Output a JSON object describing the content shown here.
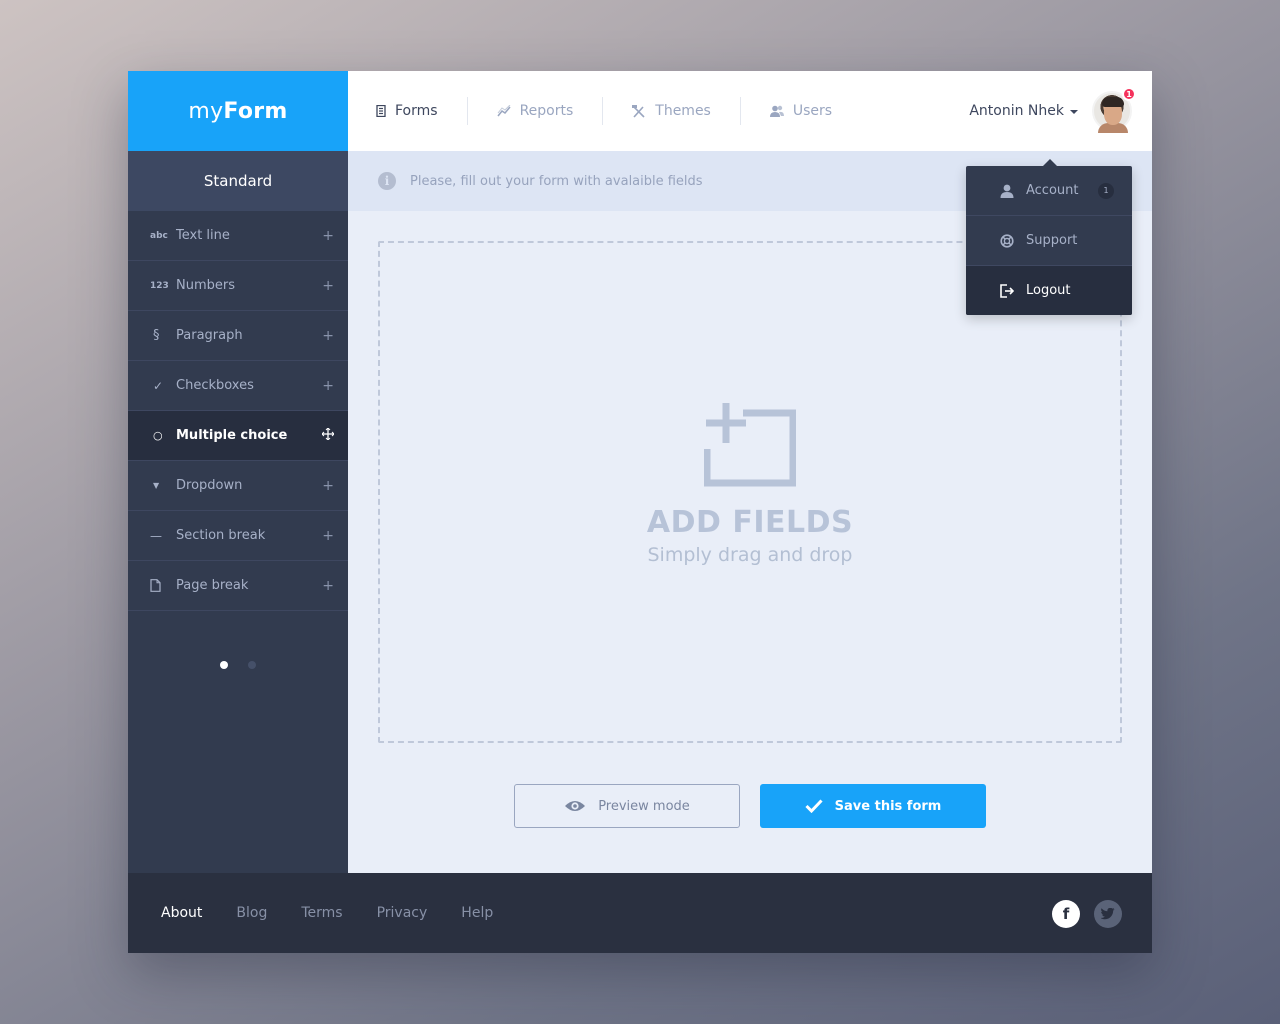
{
  "app": {
    "logo_light": "my",
    "logo_bold": "Form"
  },
  "nav": {
    "items": [
      {
        "label": "Forms",
        "icon": "form-icon"
      },
      {
        "label": "Reports",
        "icon": "chart-icon"
      },
      {
        "label": "Themes",
        "icon": "tools-icon"
      },
      {
        "label": "Users",
        "icon": "users-icon"
      }
    ],
    "user_name": "Antonin Nhek",
    "notification_count": "1"
  },
  "user_menu": {
    "items": [
      {
        "label": "Account",
        "badge": "1"
      },
      {
        "label": "Support"
      },
      {
        "label": "Logout"
      }
    ]
  },
  "sidebar": {
    "title": "Standard",
    "items": [
      {
        "icon_text": "abc",
        "label": "Text line"
      },
      {
        "icon_text": "123",
        "label": "Numbers"
      },
      {
        "icon_text": "§",
        "label": "Paragraph"
      },
      {
        "icon_text": "✓",
        "label": "Checkboxes"
      },
      {
        "icon_text": "○",
        "label": "Multiple choice",
        "active": true
      },
      {
        "icon_text": "▼",
        "label": "Dropdown"
      },
      {
        "icon_text": "—",
        "label": "Section break"
      },
      {
        "icon_text": "page",
        "label": "Page break"
      }
    ],
    "plus_glyph": "+",
    "page_dots": {
      "current": 1,
      "total": 2
    }
  },
  "info": {
    "text": "Please, fill out your form with avalaible fields",
    "icon_glyph": "i"
  },
  "dropzone": {
    "title": "ADD FIELDS",
    "subtitle": "Simply drag and drop"
  },
  "actions": {
    "preview_label": "Preview mode",
    "save_label": "Save this form"
  },
  "footer": {
    "links": [
      "About",
      "Blog",
      "Terms",
      "Privacy",
      "Help"
    ],
    "facebook_glyph": "f"
  },
  "colors": {
    "accent": "#18a3f9",
    "sidebar": "#323b4f",
    "footer": "#2a3040",
    "badge": "#f5325c"
  }
}
